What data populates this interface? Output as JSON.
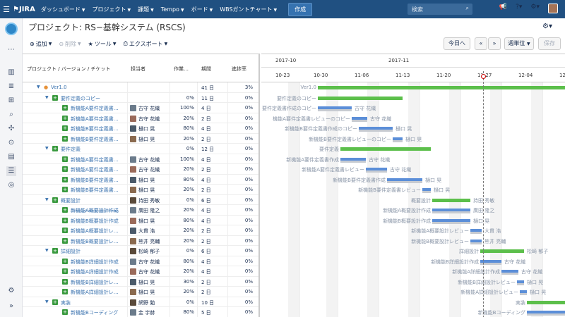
{
  "nav": {
    "logo": "JIRA",
    "items": [
      "ダッシュボード",
      "プロジェクト",
      "課題",
      "Tempo",
      "ボード",
      "WBSガントチャート"
    ],
    "create": "作成",
    "search_placeholder": "検索"
  },
  "page": {
    "title": "プロジェクト: RS−基幹システム (RSCS)"
  },
  "toolbar": {
    "add": "追加",
    "delete": "削除",
    "tools": "ツール",
    "export": "エクスポート",
    "today": "今日へ",
    "prev": "«",
    "next": "»",
    "weekly": "週単位",
    "save": "保存"
  },
  "grid": {
    "headers": {
      "project": "プロジェクト / バージョン / チケット",
      "assignee": "担当者",
      "effort": "作業…",
      "period": "期間",
      "progress": "進捗率"
    },
    "rows": [
      {
        "level": 0,
        "name": "Ver1.0",
        "assignee": "",
        "effort": "",
        "period": "41 日",
        "progress": "3%"
      },
      {
        "level": 1,
        "name": "要件定義のコピー",
        "assignee": "",
        "effort": "0%",
        "period": "11 日",
        "progress": "0%"
      },
      {
        "level": 2,
        "name": "新機能A要件定義書…",
        "assignee": "古守 花織",
        "effort": "100%",
        "period": "4 日",
        "progress": "0%"
      },
      {
        "level": 2,
        "name": "新機能A要件定義書…",
        "assignee": "古守 花織",
        "effort": "20%",
        "period": "2 日",
        "progress": "0%"
      },
      {
        "level": 2,
        "name": "新機能B要件定義書…",
        "assignee": "樋口 晃",
        "effort": "80%",
        "period": "4 日",
        "progress": "0%"
      },
      {
        "level": 2,
        "name": "新機能B要件定義書…",
        "assignee": "樋口 晃",
        "effort": "20%",
        "period": "2 日",
        "progress": "0%"
      },
      {
        "level": 1,
        "name": "要件定義",
        "assignee": "",
        "effort": "0%",
        "period": "12 日",
        "progress": "0%"
      },
      {
        "level": 2,
        "name": "新機能A要件定義書…",
        "assignee": "古守 花織",
        "effort": "100%",
        "period": "4 日",
        "progress": "0%"
      },
      {
        "level": 2,
        "name": "新機能A要件定義書…",
        "assignee": "古守 花織",
        "effort": "20%",
        "period": "2 日",
        "progress": "0%"
      },
      {
        "level": 2,
        "name": "新機能B要件定義書…",
        "assignee": "樋口 晃",
        "effort": "80%",
        "period": "4 日",
        "progress": "0%"
      },
      {
        "level": 2,
        "name": "新機能B要件定義書…",
        "assignee": "樋口 晃",
        "effort": "20%",
        "period": "2 日",
        "progress": "0%"
      },
      {
        "level": 1,
        "name": "概要設計",
        "assignee": "持田 秀敏",
        "effort": "0%",
        "period": "6 日",
        "progress": "0%"
      },
      {
        "level": 2,
        "name": "新機能A概要設計作成",
        "strike": true,
        "assignee": "廣田 隆之",
        "effort": "20%",
        "period": "4 日",
        "progress": "0%"
      },
      {
        "level": 2,
        "name": "新機能B概要設計作成",
        "assignee": "樋口 晃",
        "effort": "80%",
        "period": "4 日",
        "progress": "0%"
      },
      {
        "level": 2,
        "name": "新機能A概要設計レ…",
        "assignee": "大貫 浩",
        "effort": "20%",
        "period": "2 日",
        "progress": "0%"
      },
      {
        "level": 2,
        "name": "新機能B概要設計レ…",
        "assignee": "熊井 亮輔",
        "effort": "20%",
        "period": "2 日",
        "progress": "0%"
      },
      {
        "level": 1,
        "name": "詳細設計",
        "assignee": "松崎 郁子",
        "effort": "0%",
        "period": "6 日",
        "progress": "0%"
      },
      {
        "level": 2,
        "name": "新機能B詳細設計作成",
        "assignee": "古守 花織",
        "effort": "80%",
        "period": "4 日",
        "progress": "0%"
      },
      {
        "level": 2,
        "name": "新機能A詳細設計作成",
        "assignee": "古守 花織",
        "effort": "20%",
        "period": "4 日",
        "progress": "0%"
      },
      {
        "level": 2,
        "name": "新機能B詳細設計レ…",
        "assignee": "樋口 晃",
        "effort": "30%",
        "period": "2 日",
        "progress": "0%"
      },
      {
        "level": 2,
        "name": "新機能A詳細設計レ…",
        "assignee": "樋口 晃",
        "effort": "20%",
        "period": "2 日",
        "progress": "0%"
      },
      {
        "level": 1,
        "name": "実装",
        "assignee": "網野 勉",
        "effort": "0%",
        "period": "10 日",
        "progress": "0%"
      },
      {
        "level": 2,
        "name": "新機能Bコーディング",
        "assignee": "金 宇赫",
        "effort": "80%",
        "period": "5 日",
        "progress": "0%"
      }
    ]
  },
  "gantt": {
    "months": [
      "2017-10",
      "2017-11"
    ],
    "weeks": [
      "10-23",
      "10-30",
      "11-06",
      "11-13",
      "11-20",
      "11-27",
      "12-04",
      "12-"
    ],
    "labels": [
      "Ver1.0",
      "要件定義のコピー",
      "要件定義書作成のコピー",
      "古守 花織",
      "機能A要件定義書レビューのコピー",
      "古守 花織",
      "新機能B要件定義書作成のコピー",
      "樋口 晃",
      "新機能B要件定義書レビューのコピー",
      "樋口 晃",
      "要件定義",
      "新機能A要件定義書作成",
      "古守 花織",
      "新機能A要件定義書レビュー",
      "古守 花織",
      "新機能B要件定義書作成",
      "樋口 晃",
      "新機能B要件定義書レビュー",
      "樋口 晃",
      "概要設計",
      "持田 秀敏",
      "新機能A概要設計作成",
      "廣田 隆之",
      "新機能B概要設計作成",
      "樋口 晃",
      "新機能A概要設計レビュー",
      "大貫 浩",
      "新機能B概要設計レビュー",
      "熊井 亮輔",
      "詳細設計",
      "松崎 郁子",
      "新機能B詳細設計作成",
      "古守 花織",
      "新機能A詳細設計作成",
      "古守 花織",
      "新機能B詳細設計レビュー",
      "樋口 晃",
      "新機能A詳細設計レビュー",
      "樋口 晃",
      "実装",
      "網野 勉",
      "新機能Bコーディング"
    ]
  },
  "colors": {
    "nav": "#205081",
    "green_bar": "#5cbf4b",
    "blue_bar": "#5b8ed8",
    "today": "#cc0000"
  }
}
